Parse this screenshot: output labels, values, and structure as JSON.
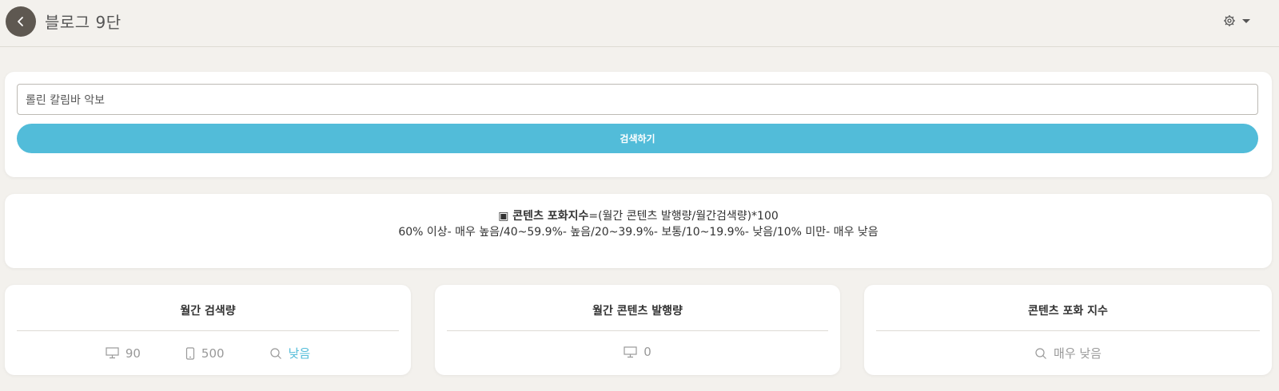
{
  "header": {
    "title": "블로그 9단"
  },
  "search": {
    "value": "롤린 칼림바 악보",
    "button_label": "검색하기"
  },
  "info": {
    "prefix": "▣ 콘텐츠 포화지수",
    "formula": "=(월간 콘텐츠 발행량/월간검색량)*100",
    "legend": "60% 이상- 매우 높음/40~59.9%- 높음/20~39.9%- 보통/10~19.9%- 낮음/10% 미만- 매우 낮음"
  },
  "stats": [
    {
      "title": "월간 검색량",
      "items": [
        {
          "icon": "desktop-icon",
          "value": "90"
        },
        {
          "icon": "mobile-icon",
          "value": "500"
        },
        {
          "icon": "search-icon",
          "value": "낮음"
        }
      ]
    },
    {
      "title": "월간 콘텐츠 발행량",
      "items": [
        {
          "icon": "desktop-icon",
          "value": "0"
        }
      ]
    },
    {
      "title": "콘텐츠 포화 지수",
      "items": [
        {
          "icon": "search-icon",
          "value": "매우 낮음"
        }
      ]
    }
  ],
  "colors": {
    "accent": "#52bcd9",
    "back_button": "#5e5851",
    "background": "#f3f1ed"
  }
}
